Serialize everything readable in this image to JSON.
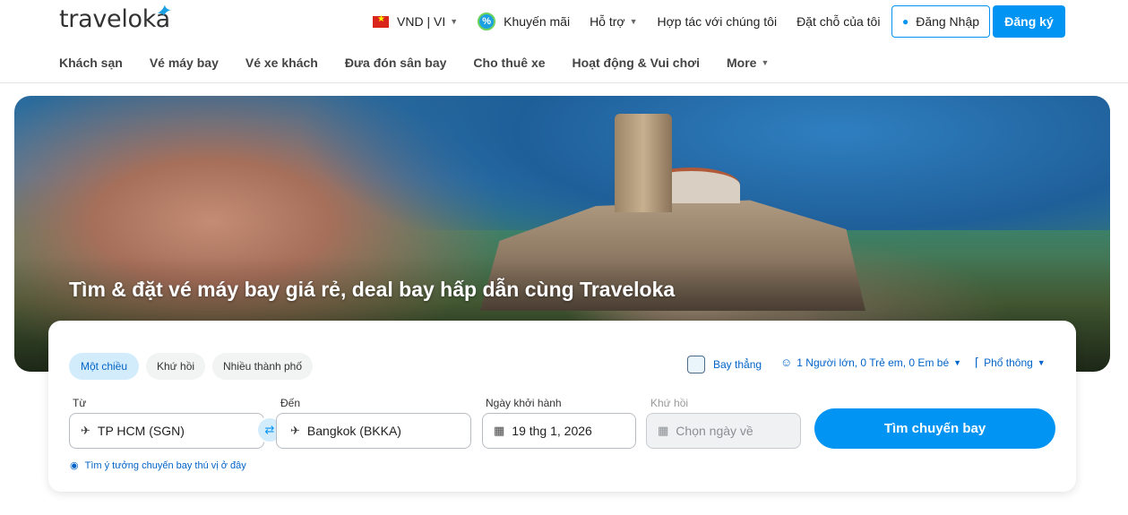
{
  "header": {
    "logo": "traveloka",
    "currency": "VND | VI",
    "top_nav": [
      "Khuyến mãi",
      "Hỗ trợ",
      "Hợp tác với chúng tôi",
      "Đặt chỗ của tôi"
    ],
    "login_label": "Đăng Nhập",
    "register_label": "Đăng ký"
  },
  "sub_nav": [
    "Khách sạn",
    "Vé máy bay",
    "Vé xe khách",
    "Đưa đón sân bay",
    "Cho thuê xe",
    "Hoạt động & Vui chơi",
    "More"
  ],
  "hero": {
    "title": "Tìm & đặt vé máy bay giá rẻ, deal bay hấp dẫn cùng Traveloka"
  },
  "search": {
    "trip_types": [
      "Một chiều",
      "Khứ hồi",
      "Nhiều thành phố"
    ],
    "active_trip_type": "Một chiều",
    "direct_label": "Bay thẳng",
    "passengers": "1 Người lớn, 0 Trẻ em, 0 Em bé",
    "cabin": "Phổ thông",
    "from_label": "Từ",
    "from_value": "TP HCM (SGN)",
    "to_label": "Đến",
    "to_value": "Bangkok (BKKA)",
    "depart_label": "Ngày khởi hành",
    "depart_value": "19 thg 1, 2026",
    "return_label": "Khứ hồi",
    "return_placeholder": "Chọn ngày về",
    "search_button": "Tìm chuyến bay",
    "idea_link": "Tìm ý tưởng chuyến bay thú vị ở đây"
  },
  "colors": {
    "brand": "#0194f3",
    "link": "#0264c8"
  }
}
